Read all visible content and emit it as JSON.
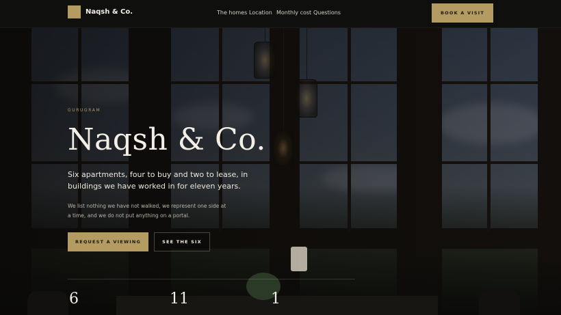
{
  "header": {
    "brand": "Naqsh & Co.",
    "nav": [
      "The homes",
      "Location",
      "Monthly cost",
      "Questions"
    ],
    "cta": "BOOK A VISIT"
  },
  "hero": {
    "eyebrow": "GURUGRAM",
    "title": "Naqsh & Co.",
    "lead": "Six apartments, four to buy and two to lease, in buildings we have worked in for eleven years.",
    "body": "We list nothing we have not walked, we represent one side at a time, and we do not put anything on a portal.",
    "primary_button": "REQUEST A VIEWING",
    "secondary_button": "SEE THE SIX"
  },
  "stats": [
    "6",
    "11",
    "1"
  ],
  "colors": {
    "accent": "#b39b62",
    "header_bg": "#0f0f0e"
  }
}
